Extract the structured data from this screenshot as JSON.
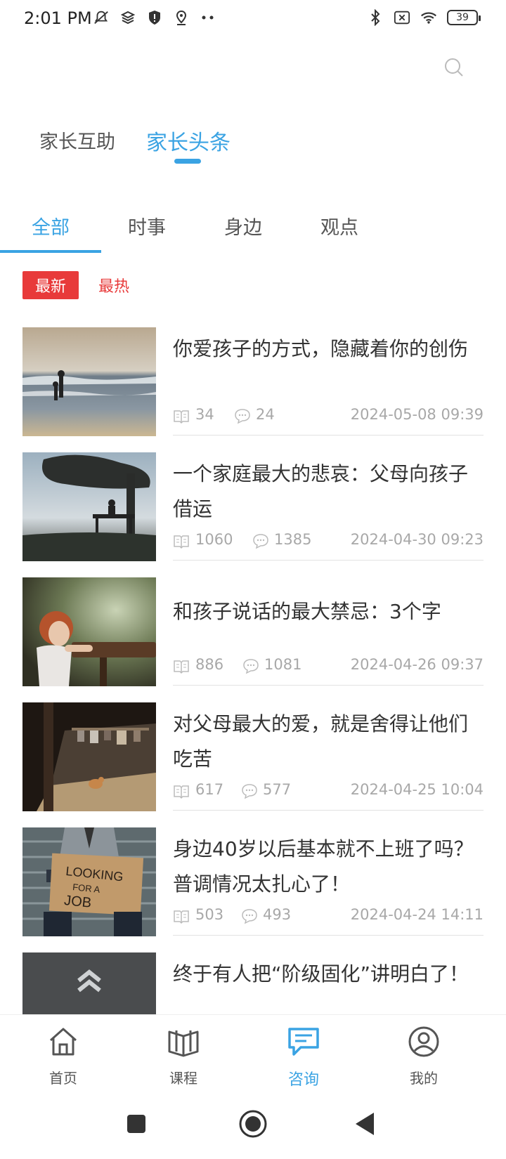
{
  "status_bar": {
    "time": "2:01 PM",
    "battery": "39",
    "left_icons": [
      "mute-icon",
      "layers-icon",
      "shield-icon",
      "location-icon",
      "more-dots-icon"
    ],
    "right_icons": [
      "bluetooth-icon",
      "no-sim-icon",
      "wifi-icon",
      "battery-icon"
    ]
  },
  "top_tabs": [
    {
      "label": "家长互助",
      "active": false
    },
    {
      "label": "家长头条",
      "active": true
    }
  ],
  "category_tabs": [
    {
      "label": "全部",
      "active": true
    },
    {
      "label": "时事",
      "active": false
    },
    {
      "label": "身边",
      "active": false
    },
    {
      "label": "观点",
      "active": false
    }
  ],
  "sort": {
    "newest": "最新",
    "hottest": "最热"
  },
  "articles": [
    {
      "title": "你爱孩子的方式，隐藏着你的创伤",
      "views": "34",
      "comments": "24",
      "date": "2024-05-08 09:39",
      "image": "beach-parent-child-photo"
    },
    {
      "title": "一个家庭最大的悲哀：父母向孩子借运",
      "views": "1060",
      "comments": "1385",
      "date": "2024-04-30 09:23",
      "image": "bench-under-tree-silhouette-photo"
    },
    {
      "title": "和孩子说话的最大禁忌：3个字",
      "views": "886",
      "comments": "1081",
      "date": "2024-04-26 09:37",
      "image": "girl-leaning-on-bench-photo"
    },
    {
      "title": "对父母最大的爱，就是舍得让他们吃苦",
      "views": "617",
      "comments": "577",
      "date": "2024-04-25 10:04",
      "image": "village-alley-cat-photo"
    },
    {
      "title": "身边40岁以后基本就不上班了吗？普调情况太扎心了！",
      "views": "503",
      "comments": "493",
      "date": "2024-04-24 14:11",
      "image": "looking-for-a-job-sign-photo",
      "sign_text": "LOOKING FOR A JOB"
    },
    {
      "title": "终于有人把“阶级固化”讲明白了！",
      "image": "road-arrow-photo"
    }
  ],
  "bottom_nav": [
    {
      "label": "首页",
      "icon": "home-icon",
      "active": false
    },
    {
      "label": "课程",
      "icon": "book-icon",
      "active": false
    },
    {
      "label": "咨询",
      "icon": "chat-icon",
      "active": true
    },
    {
      "label": "我的",
      "icon": "profile-icon",
      "active": false
    }
  ],
  "colors": {
    "accent": "#3aa3e3",
    "sort_active": "#e83a3a",
    "meta_gray": "#a8a8a8"
  }
}
